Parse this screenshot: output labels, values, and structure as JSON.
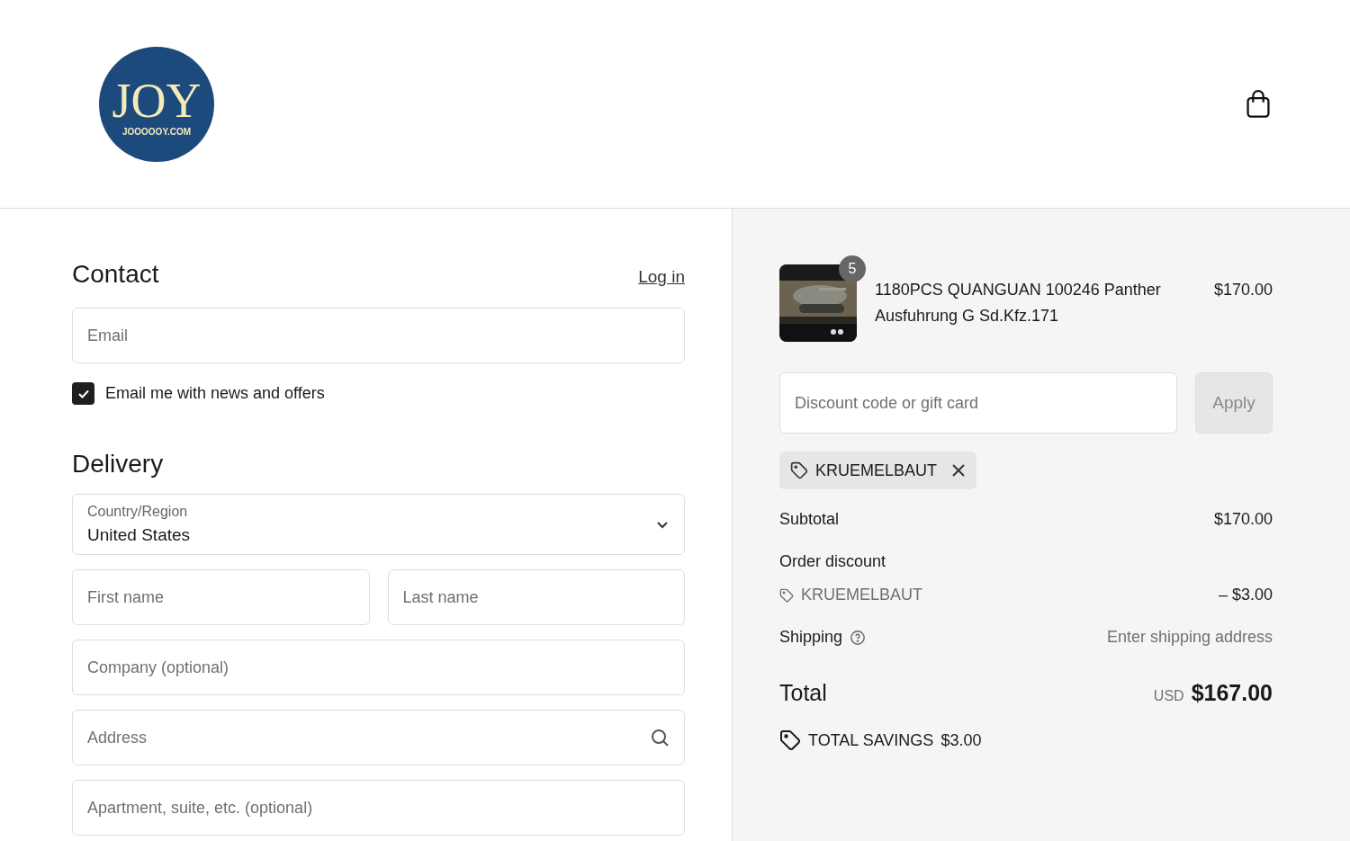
{
  "logo": {
    "title": "JOY",
    "subtitle": "JOOOOOY.COM"
  },
  "contact": {
    "heading": "Contact",
    "login": "Log in",
    "email": {
      "placeholder": "Email"
    },
    "newsletter": {
      "label": "Email me with news and offers",
      "checked": true
    }
  },
  "delivery": {
    "heading": "Delivery",
    "country": {
      "label": "Country/Region",
      "value": "United States"
    },
    "fields": [
      {
        "kind": "pair",
        "items": [
          {
            "placeholder": "First name"
          },
          {
            "placeholder": "Last name"
          }
        ]
      },
      {
        "kind": "text",
        "placeholder": "Company (optional)"
      },
      {
        "kind": "search",
        "placeholder": "Address"
      },
      {
        "kind": "text",
        "placeholder": "Apartment, suite, etc. (optional)"
      }
    ]
  },
  "summary": {
    "item": {
      "quantity": "5",
      "name": "1180PCS QUANGUAN 100246 Panther Ausfuhrung G Sd.Kfz.171",
      "price": "$170.00"
    },
    "discount": {
      "placeholder": "Discount code or gift card",
      "button": "Apply",
      "disabled": true
    },
    "applied_code": "KRUEMELBAUT",
    "subtotal": {
      "label": "Subtotal",
      "value": "$170.00"
    },
    "order_discount": {
      "label": "Order discount",
      "code": "KRUEMELBAUT",
      "value": "– $3.00"
    },
    "shipping": {
      "label": "Shipping",
      "value": "Enter shipping address"
    },
    "total": {
      "label": "Total",
      "currency": "USD",
      "value": "$167.00"
    },
    "savings": {
      "label": "TOTAL SAVINGS",
      "value": "$3.00"
    }
  }
}
